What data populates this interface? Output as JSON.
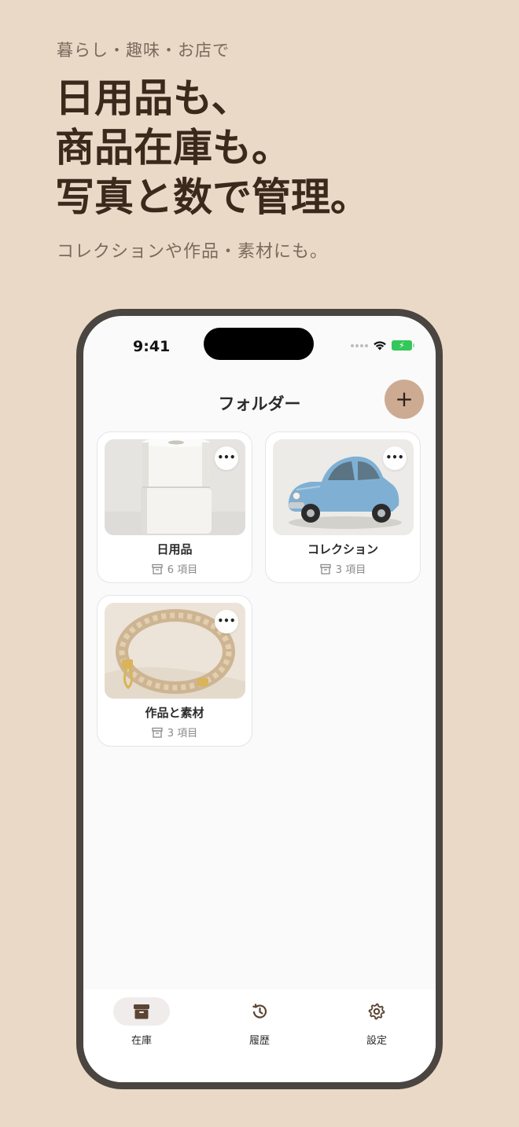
{
  "promo": {
    "subtitle": "暮らし・趣味・お店で",
    "headline": [
      "日用品も、",
      "商品在庫も。",
      "写真と数で管理。"
    ],
    "tagline": "コレクションや作品・素材にも。"
  },
  "status_bar": {
    "time": "9:41"
  },
  "nav": {
    "title": "フォルダー",
    "add_label": "+"
  },
  "folders": [
    {
      "name": "日用品",
      "count": "6 項目",
      "more": "•••",
      "image": "toilet-paper-rolls"
    },
    {
      "name": "コレクション",
      "count": "3 項目",
      "more": "•••",
      "image": "blue-toy-car"
    },
    {
      "name": "作品と素材",
      "count": "3 項目",
      "more": "•••",
      "image": "braided-cord-strap"
    }
  ],
  "tabs": [
    {
      "label": "在庫",
      "icon": "archive-box-icon"
    },
    {
      "label": "履歴",
      "icon": "history-icon"
    },
    {
      "label": "設定",
      "icon": "gear-icon"
    }
  ],
  "colors": {
    "background": "#ead9c7",
    "headline": "#3b2a1c",
    "accent_button": "#cdab93",
    "phone_frame": "#4a4540"
  }
}
